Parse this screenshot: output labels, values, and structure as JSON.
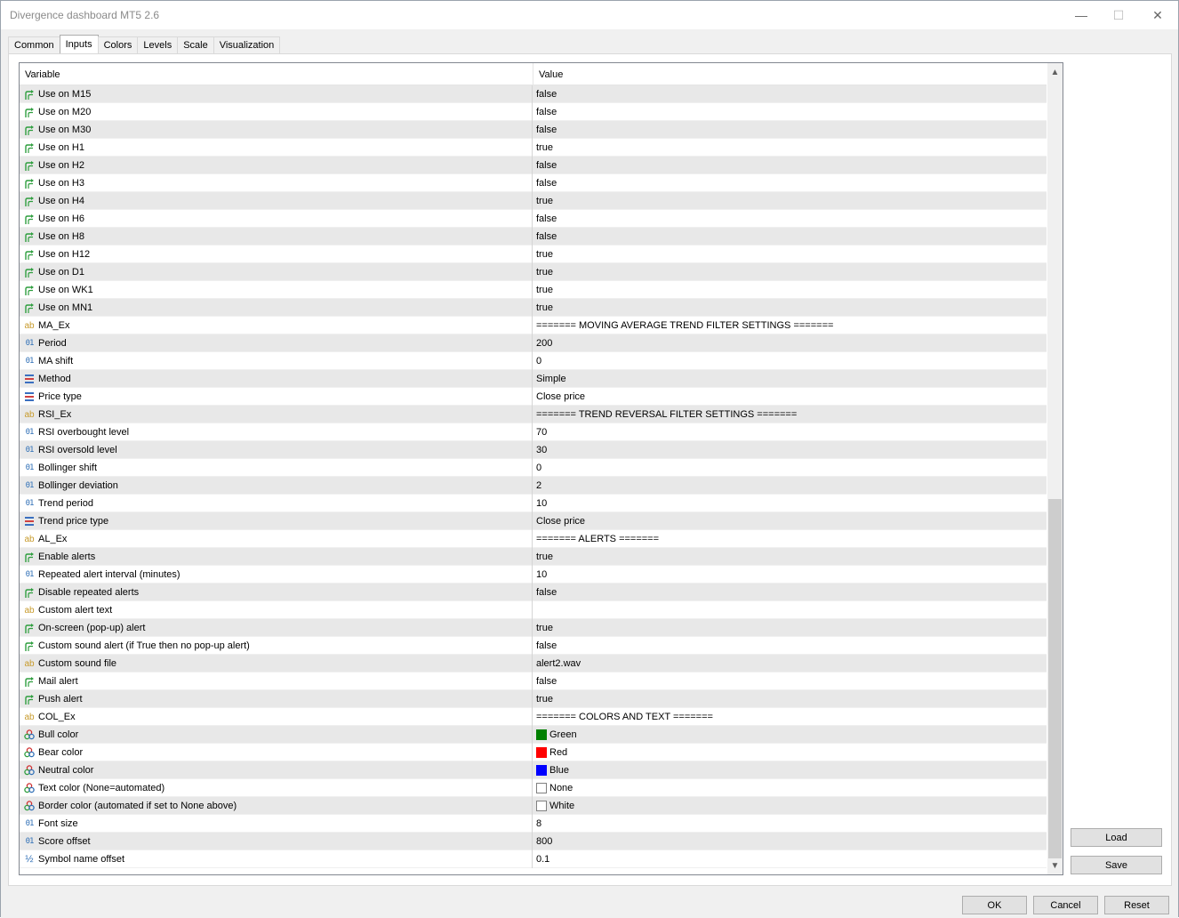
{
  "window": {
    "title": "Divergence dashboard MT5 2.6",
    "minimize": "—",
    "maximize": "☐",
    "close": "✕"
  },
  "tabs": [
    {
      "label": "Common",
      "active": false
    },
    {
      "label": "Inputs",
      "active": true
    },
    {
      "label": "Colors",
      "active": false
    },
    {
      "label": "Levels",
      "active": false
    },
    {
      "label": "Scale",
      "active": false
    },
    {
      "label": "Visualization",
      "active": false
    }
  ],
  "grid": {
    "headers": {
      "variable": "Variable",
      "value": "Value"
    },
    "rows": [
      {
        "icon": "bool-arrow-icon",
        "variable": "Use on M15",
        "value": "false"
      },
      {
        "icon": "bool-arrow-icon",
        "variable": "Use on M20",
        "value": "false"
      },
      {
        "icon": "bool-arrow-icon",
        "variable": "Use on M30",
        "value": "false"
      },
      {
        "icon": "bool-arrow-icon",
        "variable": "Use on H1",
        "value": "true"
      },
      {
        "icon": "bool-arrow-icon",
        "variable": "Use on H2",
        "value": "false"
      },
      {
        "icon": "bool-arrow-icon",
        "variable": "Use on H3",
        "value": "false"
      },
      {
        "icon": "bool-arrow-icon",
        "variable": "Use on H4",
        "value": "true"
      },
      {
        "icon": "bool-arrow-icon",
        "variable": "Use on H6",
        "value": "false"
      },
      {
        "icon": "bool-arrow-icon",
        "variable": "Use on H8",
        "value": "false"
      },
      {
        "icon": "bool-arrow-icon",
        "variable": "Use on H12",
        "value": "true"
      },
      {
        "icon": "bool-arrow-icon",
        "variable": "Use on D1",
        "value": "true"
      },
      {
        "icon": "bool-arrow-icon",
        "variable": "Use on WK1",
        "value": "true"
      },
      {
        "icon": "bool-arrow-icon",
        "variable": "Use on MN1",
        "value": "true"
      },
      {
        "icon": "string-ab-icon",
        "variable": "MA_Ex",
        "value": "======= MOVING AVERAGE TREND FILTER SETTINGS ======="
      },
      {
        "icon": "integer-01-icon",
        "variable": "Period",
        "value": "200"
      },
      {
        "icon": "integer-01-icon",
        "variable": "MA shift",
        "value": "0"
      },
      {
        "icon": "enum-list-icon",
        "variable": "Method",
        "value": "Simple"
      },
      {
        "icon": "enum-list-icon",
        "variable": "Price type",
        "value": "Close price"
      },
      {
        "icon": "string-ab-icon",
        "variable": "RSI_Ex",
        "value": "======= TREND REVERSAL FILTER SETTINGS ======="
      },
      {
        "icon": "integer-01-icon",
        "variable": "RSI overbought level",
        "value": "70"
      },
      {
        "icon": "integer-01-icon",
        "variable": "RSI oversold level",
        "value": "30"
      },
      {
        "icon": "integer-01-icon",
        "variable": "Bollinger shift",
        "value": "0"
      },
      {
        "icon": "integer-01-icon",
        "variable": "Bollinger deviation",
        "value": "2"
      },
      {
        "icon": "integer-01-icon",
        "variable": "Trend period",
        "value": "10"
      },
      {
        "icon": "enum-list-icon",
        "variable": "Trend price type",
        "value": "Close price"
      },
      {
        "icon": "string-ab-icon",
        "variable": "AL_Ex",
        "value": "======= ALERTS ======="
      },
      {
        "icon": "bool-arrow-icon",
        "variable": "Enable alerts",
        "value": "true"
      },
      {
        "icon": "integer-01-icon",
        "variable": "Repeated alert interval (minutes)",
        "value": "10"
      },
      {
        "icon": "bool-arrow-icon",
        "variable": "Disable repeated alerts",
        "value": "false"
      },
      {
        "icon": "string-ab-icon",
        "variable": "Custom alert text",
        "value": ""
      },
      {
        "icon": "bool-arrow-icon",
        "variable": "On-screen (pop-up) alert",
        "value": "true"
      },
      {
        "icon": "bool-arrow-icon",
        "variable": "Custom sound alert (if True then no pop-up alert)",
        "value": "false"
      },
      {
        "icon": "string-ab-icon",
        "variable": "Custom sound file",
        "value": "alert2.wav"
      },
      {
        "icon": "bool-arrow-icon",
        "variable": "Mail alert",
        "value": "false"
      },
      {
        "icon": "bool-arrow-icon",
        "variable": "Push alert",
        "value": "true"
      },
      {
        "icon": "string-ab-icon",
        "variable": "COL_Ex",
        "value": "======= COLORS AND TEXT ======="
      },
      {
        "icon": "color-palette-icon",
        "variable": "Bull color",
        "value": "Green",
        "swatch": "#008000"
      },
      {
        "icon": "color-palette-icon",
        "variable": "Bear color",
        "value": "Red",
        "swatch": "#ff0000"
      },
      {
        "icon": "color-palette-icon",
        "variable": "Neutral color",
        "value": "Blue",
        "swatch": "#0000ff"
      },
      {
        "icon": "color-palette-icon",
        "variable": "Text color (None=automated)",
        "value": "None",
        "swatch": "#ffffff"
      },
      {
        "icon": "color-palette-icon",
        "variable": "Border color (automated if set to None above)",
        "value": "White",
        "swatch": "#ffffff"
      },
      {
        "icon": "integer-01-icon",
        "variable": "Font size",
        "value": "8"
      },
      {
        "icon": "integer-01-icon",
        "variable": "Score offset",
        "value": "800"
      },
      {
        "icon": "double-half-icon",
        "variable": "Symbol name offset",
        "value": "0.1"
      }
    ]
  },
  "side_buttons": {
    "load": "Load",
    "save": "Save"
  },
  "bottom_buttons": {
    "ok": "OK",
    "cancel": "Cancel",
    "reset": "Reset"
  },
  "colors": {
    "bool_icon": "#2e9e3e",
    "string_icon": "#c79a2a",
    "number_icon": "#2f6fb6",
    "row_alt": "#e8e8e8"
  }
}
